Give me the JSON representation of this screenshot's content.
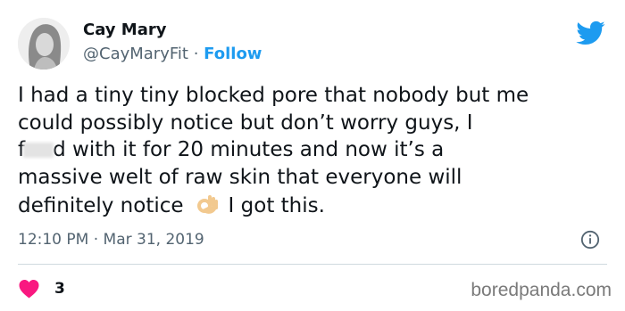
{
  "author": {
    "display_name": "Cay Mary",
    "handle": "@CayMaryFit",
    "separator": "·",
    "follow_label": "Follow"
  },
  "tweet": {
    "line1": "I had a tiny tiny blocked pore that nobody but me",
    "line2": "could possibly notice but don’t worry guys, I",
    "line3_start": "f",
    "line3_end": "d with it for 20 minutes and now it’s a",
    "line4": "massive welt of raw skin that everyone will",
    "line5_start": "definitely notice",
    "line5_end": "I got this."
  },
  "meta": {
    "time": "12:10 PM",
    "separator": "·",
    "date": "Mar 31, 2019"
  },
  "engagement": {
    "likes": "3"
  },
  "watermark": "boredpanda.com",
  "icons": {
    "brand": "twitter-bird-icon",
    "info": "info-icon",
    "like": "heart-icon",
    "emoji": "ok-hand-icon"
  },
  "colors": {
    "accent": "#1d9bf0",
    "heart": "#f91880",
    "secondary_text": "#536471",
    "divider": "#cfd9de"
  }
}
